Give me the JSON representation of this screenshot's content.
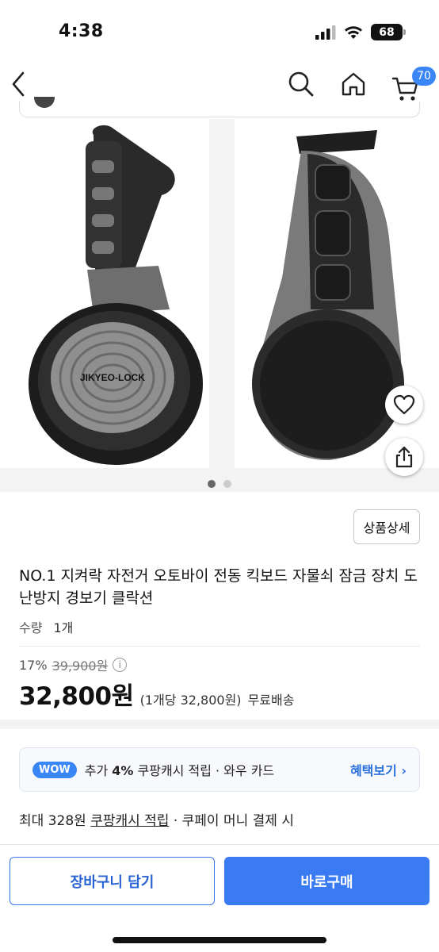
{
  "status_bar": {
    "time": "4:38",
    "battery": "68"
  },
  "nav": {
    "cart_count": "70"
  },
  "gallery": {
    "image_count": 2,
    "active_index": 0,
    "left_logo_text": "JIKYEO-LOCK"
  },
  "product": {
    "detail_button": "상품상세",
    "title": "NO.1 지켜락 자전거 오토바이 전동 킥보드 자물쇠 잠금 장치 도난방지 경보기 클락션",
    "quantity_label": "수량",
    "quantity_value": "1개",
    "discount_rate": "17%",
    "original_price": "39,900원",
    "price": "32,800원",
    "unit_price_text": "(1개당 32,800원)",
    "shipping": "무료배송"
  },
  "wow": {
    "badge": "WOW",
    "text_prefix": "추가 ",
    "text_percent": "4%",
    "text_suffix": " 쿠팡캐시 적립 · 와우 카드",
    "link": "혜택보기 ›"
  },
  "cash_line": {
    "prefix": "최대 328원 ",
    "link": "쿠팡캐시 적립",
    "suffix": " · 쿠페이 머니 결제 시"
  },
  "bottom": {
    "cart_button": "장바구니 담기",
    "buy_button": "바로구매"
  },
  "colors": {
    "accent": "#3a7af3",
    "badge": "#3b86f7",
    "link": "#2a6fdb"
  }
}
